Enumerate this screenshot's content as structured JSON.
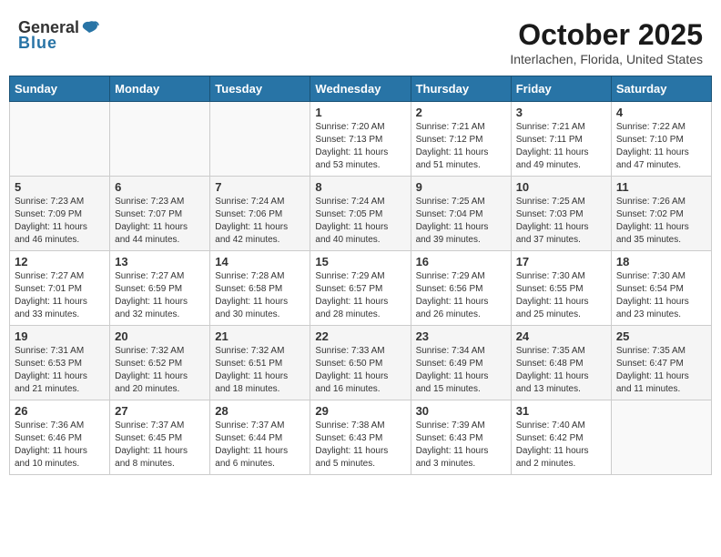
{
  "header": {
    "logo_general": "General",
    "logo_blue": "Blue",
    "month_title": "October 2025",
    "location": "Interlachen, Florida, United States"
  },
  "weekdays": [
    "Sunday",
    "Monday",
    "Tuesday",
    "Wednesday",
    "Thursday",
    "Friday",
    "Saturday"
  ],
  "weeks": [
    [
      {
        "day": "",
        "info": ""
      },
      {
        "day": "",
        "info": ""
      },
      {
        "day": "",
        "info": ""
      },
      {
        "day": "1",
        "info": "Sunrise: 7:20 AM\nSunset: 7:13 PM\nDaylight: 11 hours\nand 53 minutes."
      },
      {
        "day": "2",
        "info": "Sunrise: 7:21 AM\nSunset: 7:12 PM\nDaylight: 11 hours\nand 51 minutes."
      },
      {
        "day": "3",
        "info": "Sunrise: 7:21 AM\nSunset: 7:11 PM\nDaylight: 11 hours\nand 49 minutes."
      },
      {
        "day": "4",
        "info": "Sunrise: 7:22 AM\nSunset: 7:10 PM\nDaylight: 11 hours\nand 47 minutes."
      }
    ],
    [
      {
        "day": "5",
        "info": "Sunrise: 7:23 AM\nSunset: 7:09 PM\nDaylight: 11 hours\nand 46 minutes."
      },
      {
        "day": "6",
        "info": "Sunrise: 7:23 AM\nSunset: 7:07 PM\nDaylight: 11 hours\nand 44 minutes."
      },
      {
        "day": "7",
        "info": "Sunrise: 7:24 AM\nSunset: 7:06 PM\nDaylight: 11 hours\nand 42 minutes."
      },
      {
        "day": "8",
        "info": "Sunrise: 7:24 AM\nSunset: 7:05 PM\nDaylight: 11 hours\nand 40 minutes."
      },
      {
        "day": "9",
        "info": "Sunrise: 7:25 AM\nSunset: 7:04 PM\nDaylight: 11 hours\nand 39 minutes."
      },
      {
        "day": "10",
        "info": "Sunrise: 7:25 AM\nSunset: 7:03 PM\nDaylight: 11 hours\nand 37 minutes."
      },
      {
        "day": "11",
        "info": "Sunrise: 7:26 AM\nSunset: 7:02 PM\nDaylight: 11 hours\nand 35 minutes."
      }
    ],
    [
      {
        "day": "12",
        "info": "Sunrise: 7:27 AM\nSunset: 7:01 PM\nDaylight: 11 hours\nand 33 minutes."
      },
      {
        "day": "13",
        "info": "Sunrise: 7:27 AM\nSunset: 6:59 PM\nDaylight: 11 hours\nand 32 minutes."
      },
      {
        "day": "14",
        "info": "Sunrise: 7:28 AM\nSunset: 6:58 PM\nDaylight: 11 hours\nand 30 minutes."
      },
      {
        "day": "15",
        "info": "Sunrise: 7:29 AM\nSunset: 6:57 PM\nDaylight: 11 hours\nand 28 minutes."
      },
      {
        "day": "16",
        "info": "Sunrise: 7:29 AM\nSunset: 6:56 PM\nDaylight: 11 hours\nand 26 minutes."
      },
      {
        "day": "17",
        "info": "Sunrise: 7:30 AM\nSunset: 6:55 PM\nDaylight: 11 hours\nand 25 minutes."
      },
      {
        "day": "18",
        "info": "Sunrise: 7:30 AM\nSunset: 6:54 PM\nDaylight: 11 hours\nand 23 minutes."
      }
    ],
    [
      {
        "day": "19",
        "info": "Sunrise: 7:31 AM\nSunset: 6:53 PM\nDaylight: 11 hours\nand 21 minutes."
      },
      {
        "day": "20",
        "info": "Sunrise: 7:32 AM\nSunset: 6:52 PM\nDaylight: 11 hours\nand 20 minutes."
      },
      {
        "day": "21",
        "info": "Sunrise: 7:32 AM\nSunset: 6:51 PM\nDaylight: 11 hours\nand 18 minutes."
      },
      {
        "day": "22",
        "info": "Sunrise: 7:33 AM\nSunset: 6:50 PM\nDaylight: 11 hours\nand 16 minutes."
      },
      {
        "day": "23",
        "info": "Sunrise: 7:34 AM\nSunset: 6:49 PM\nDaylight: 11 hours\nand 15 minutes."
      },
      {
        "day": "24",
        "info": "Sunrise: 7:35 AM\nSunset: 6:48 PM\nDaylight: 11 hours\nand 13 minutes."
      },
      {
        "day": "25",
        "info": "Sunrise: 7:35 AM\nSunset: 6:47 PM\nDaylight: 11 hours\nand 11 minutes."
      }
    ],
    [
      {
        "day": "26",
        "info": "Sunrise: 7:36 AM\nSunset: 6:46 PM\nDaylight: 11 hours\nand 10 minutes."
      },
      {
        "day": "27",
        "info": "Sunrise: 7:37 AM\nSunset: 6:45 PM\nDaylight: 11 hours\nand 8 minutes."
      },
      {
        "day": "28",
        "info": "Sunrise: 7:37 AM\nSunset: 6:44 PM\nDaylight: 11 hours\nand 6 minutes."
      },
      {
        "day": "29",
        "info": "Sunrise: 7:38 AM\nSunset: 6:43 PM\nDaylight: 11 hours\nand 5 minutes."
      },
      {
        "day": "30",
        "info": "Sunrise: 7:39 AM\nSunset: 6:43 PM\nDaylight: 11 hours\nand 3 minutes."
      },
      {
        "day": "31",
        "info": "Sunrise: 7:40 AM\nSunset: 6:42 PM\nDaylight: 11 hours\nand 2 minutes."
      },
      {
        "day": "",
        "info": ""
      }
    ]
  ]
}
